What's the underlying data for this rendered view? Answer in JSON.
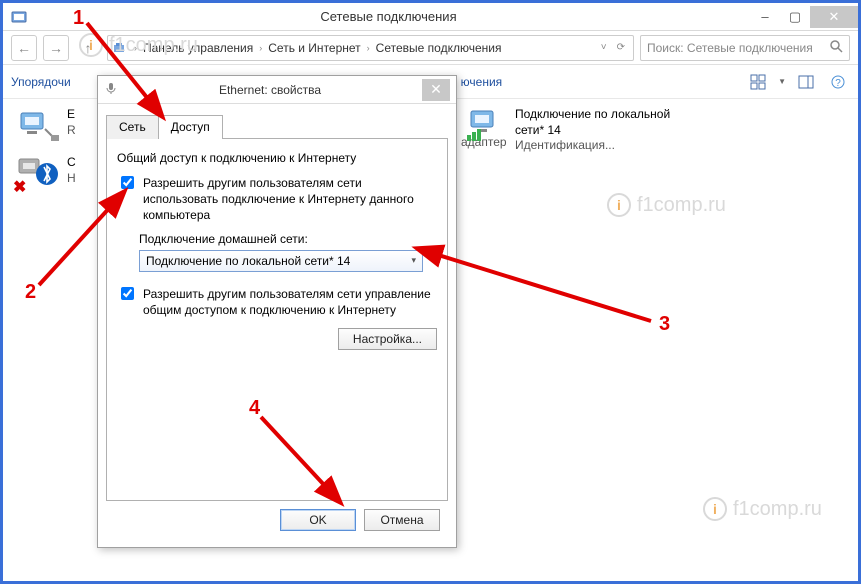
{
  "window": {
    "title": "Сетевые подключения",
    "min": "–",
    "max": "▢",
    "close": "✕"
  },
  "nav": {
    "back": "←",
    "forward": "→",
    "up": "↑",
    "refresh": "⟳"
  },
  "breadcrumb": {
    "items": [
      "Панель управления",
      "Сеть и Интернет",
      "Сетевые подключения"
    ],
    "sep": "›"
  },
  "search": {
    "placeholder": "Поиск: Сетевые подключения"
  },
  "toolbar": {
    "organize": "Упорядочи",
    "title": "ючения"
  },
  "left_items": [
    {
      "line1": "E",
      "line2": "R"
    },
    {
      "line1": "С",
      "line2": "Н"
    }
  ],
  "center_text": "адаптер",
  "right_item": {
    "line1": "Подключение по локальной",
    "line2": "сети* 14",
    "line3": "Идентификация..."
  },
  "dialog": {
    "title": "Ethernet: свойства",
    "close": "✕",
    "tabs": {
      "network": "Сеть",
      "access": "Доступ"
    },
    "group_title": "Общий доступ к подключению к Интернету",
    "check1": "Разрешить другим пользователям сети использовать подключение к Интернету данного компьютера",
    "home_label": "Подключение домашней сети:",
    "combo_value": "Подключение по локальной сети* 14",
    "check2": "Разрешить другим пользователям сети управление общим доступом к подключению к Интернету",
    "settings_btn": "Настройка...",
    "ok": "OK",
    "cancel": "Отмена"
  },
  "annotations": {
    "n1": "1",
    "n2": "2",
    "n3": "3",
    "n4": "4"
  },
  "watermark": "f1comp.ru"
}
